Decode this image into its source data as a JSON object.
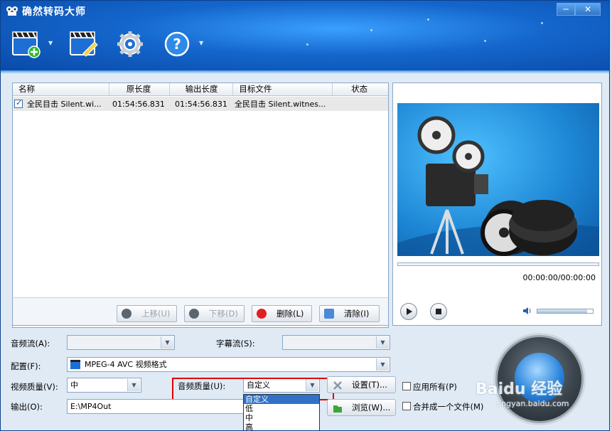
{
  "window": {
    "title": "确然转码大师"
  },
  "toolbar": {
    "icons": [
      "add-video-icon",
      "edit-video-icon",
      "settings-gear-icon",
      "help-icon"
    ]
  },
  "file_list": {
    "columns": [
      "名称",
      "原长度",
      "输出长度",
      "目标文件",
      "状态"
    ],
    "rows": [
      {
        "checked": true,
        "name": "全民目击 Silent.wi...",
        "orig_length": "01:54:56.831",
        "out_length": "01:54:56.831",
        "target": "全民目击 Silent.witnes...",
        "status": ""
      }
    ]
  },
  "list_buttons": {
    "move_up": "上移(U)",
    "move_down": "下移(D)",
    "delete": "删除(L)",
    "clear": "清除(I)"
  },
  "preview": {
    "time": "00:00:00/00:00:00",
    "volume_fraction": 0.9
  },
  "settings": {
    "audio_stream_label": "音频流(A):",
    "subtitle_stream_label": "字幕流(S):",
    "profile_label": "配置(F):",
    "profile_value": "MPEG-4 AVC 视频格式",
    "video_quality_label": "视频质量(V):",
    "video_quality_value": "中",
    "audio_quality_label": "音频质量(U):",
    "audio_quality_value": "自定义",
    "audio_quality_options": [
      "自定义",
      "低",
      "中",
      "高"
    ],
    "settings_button": "设置(T)...",
    "browse_button": "浏览(W)...",
    "apply_all": "应用所有(P)",
    "merge_one": "合并成一个文件(M)",
    "output_label": "输出(O):",
    "output_value": "E:\\MP4Out"
  },
  "watermark": {
    "brand": "Baidu 经验",
    "url": "jingyan.baidu.com"
  }
}
